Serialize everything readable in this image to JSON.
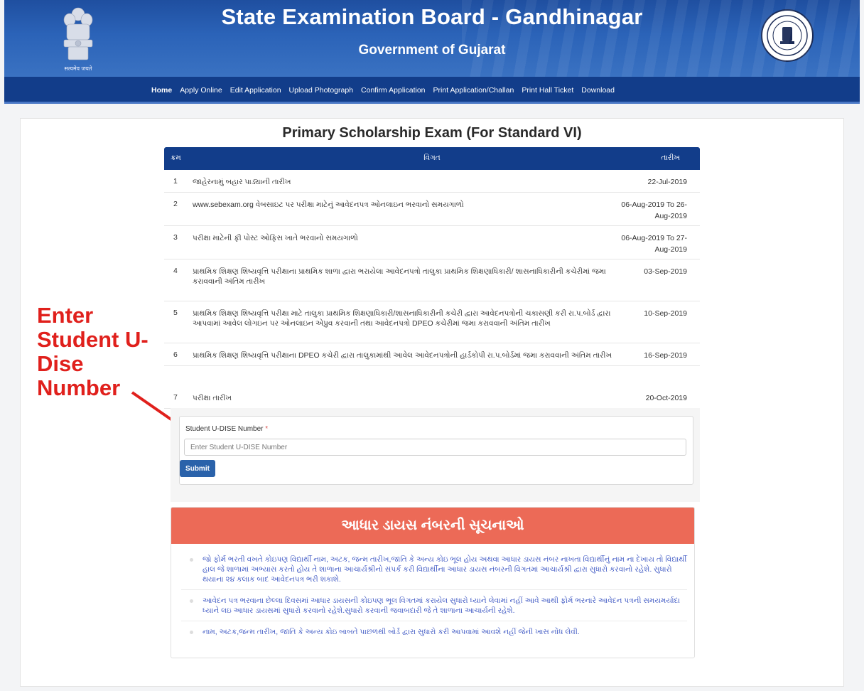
{
  "header": {
    "title": "State Examination Board - Gandhinagar",
    "subtitle": "Government of Gujarat",
    "emblem_caption": "सत्यमेव जयते",
    "colors": {
      "banner": "#2b63b8",
      "nav": "#123d8a"
    }
  },
  "nav": {
    "items": [
      {
        "label": "Home",
        "active": true
      },
      {
        "label": "Apply Online"
      },
      {
        "label": "Edit Application"
      },
      {
        "label": "Upload Photograph"
      },
      {
        "label": "Confirm Application"
      },
      {
        "label": "Print Application/Challan"
      },
      {
        "label": "Print Hall Ticket"
      },
      {
        "label": "Download"
      }
    ]
  },
  "page": {
    "title": "Primary Scholarship Exam (For Standard VI)"
  },
  "schedule": {
    "headers": {
      "no": "ક્રમ",
      "detail": "વિગત",
      "date": "તારીખ"
    },
    "rows": [
      {
        "no": "1",
        "desc": "જાહેરનામું બહાર પાડ્યાની તારીખ",
        "date": "22-Jul-2019"
      },
      {
        "no": "2",
        "desc": "www.sebexam.org વેબસાઇટ પર પરીક્ષા માટેનું આવેદનપત્ર ઓનલાઇન ભરવાનો સમયગાળો",
        "date": "06-Aug-2019 To 26-Aug-2019"
      },
      {
        "no": "3",
        "desc": "પરીક્ષા માટેની ફી પોસ્ટ ઓફિસ ખાતે ભરવાનો સમયગાળો",
        "date": "06-Aug-2019 To 27-Aug-2019"
      },
      {
        "no": "4",
        "desc": "પ્રાથમિક શિક્ષણ શિષ્યવૃત્તિ પરીક્ષાના પ્રાથમિક શાળા દ્વારા ભરાયેલા આવેદનપત્રો તાલુકા પ્રાથમિક શિક્ષણાધિકારી/ શાસનાધિકારીની કચેરીમાં જમા કરાવવાની અંતિમ તારીખ",
        "date": "03-Sep-2019"
      },
      {
        "no": "5",
        "desc": "પ્રાથમિક શિક્ષણ શિષ્યવૃત્તિ પરીક્ષા માટે તાલુકા પ્રાથમિક શિક્ષણાધિકારી/શાસનાધિકારીની કચેરી દ્વારા આવેદનપત્રોની ચકાસણી કરી રા.પ.બોર્ડ દ્વારા આપવામાં આવેલ લોગઇન પર ઓનલાઇન એપ્રુવ કરવાની તથા આવેદનપત્રો DPEO કચેરીમાં જમા કરાવવાની અંતિમ તારીખ",
        "date": "10-Sep-2019"
      },
      {
        "no": "6",
        "desc": "પ્રાથમિક શિક્ષણ શિષ્યવૃત્તિ પરીક્ષાના DPEO કચેરી દ્વારા તાલુકામાંથી આવેલ આવેદનપત્રોની હાર્ડકોપી રા.પ.બોર્ડમાં જમા કરાવવાની અંતિમ તારીખ",
        "date": "16-Sep-2019"
      },
      {
        "no": "7",
        "desc": "પરીક્ષા તારીખ",
        "date": "20-Oct-2019"
      }
    ]
  },
  "annotation": {
    "text": "Enter Student U-Dise Number",
    "color": "#e0201c"
  },
  "form": {
    "label": "Student U-DISE Number",
    "required_mark": "*",
    "placeholder": "Enter Student U-DISE Number",
    "value": "",
    "submit_label": "Submit"
  },
  "notice": {
    "title": "આધાર ડાયસ નંબરની સૂચનાઓ",
    "items": [
      "જો ફોર્મ ભરતી વખતે કોઇપણ વિદ્યાર્થી નામ, અટક, જન્મ તારીખ,જાતિ કે અન્ય કોઇ ભૂલ હોય અથવા આધાર ડાયસ નંબર નાખતા વિદ્યાર્થીનું નામ ના દેખાય તો વિદ્યાર્થી હાલ જે શાળામાં અભ્યાસ કરતો હોય તે શાળાના આચાર્યશ્રીનો સંપર્ક કરી વિદ્યાર્થીના આધાર ડાયસ નંબરની વિગતમાં આચાર્યશ્રી દ્વારા સુધારો કરવાનો રહેશે. સુધારો થયાના ૨૪ કલાક બાદ આવેદનપત્ર ભરી શકાશે.",
      "આવેદન પત્ર ભરવાના છેલ્લા દિવસમાં આધાર ડાયસની કોઇપણ ભૂલ વિગતમાં કરાયેલ સુધારો ધ્યાને લેવામાં નહીં આવે આથી ફોર્મ ભરનારે આવેદન પત્રની સમયમર્યાદા ધ્યાને લઇ આધાર ડાયસમાં સુધારો કરવાનો રહેશે.સુધારો કરવાની જવાબદારી જે તે શાળાના આચાર્યની રહેશે.",
      "નામ, અટક,જન્મ તારીખ, જાતિ કે અન્ય કોઇ બાબતે પાછળથી બોર્ડ દ્વારા સુધારો કરી આપવામાં આવશે નહીં જેની ખાસ નોંધ લેવી."
    ]
  }
}
